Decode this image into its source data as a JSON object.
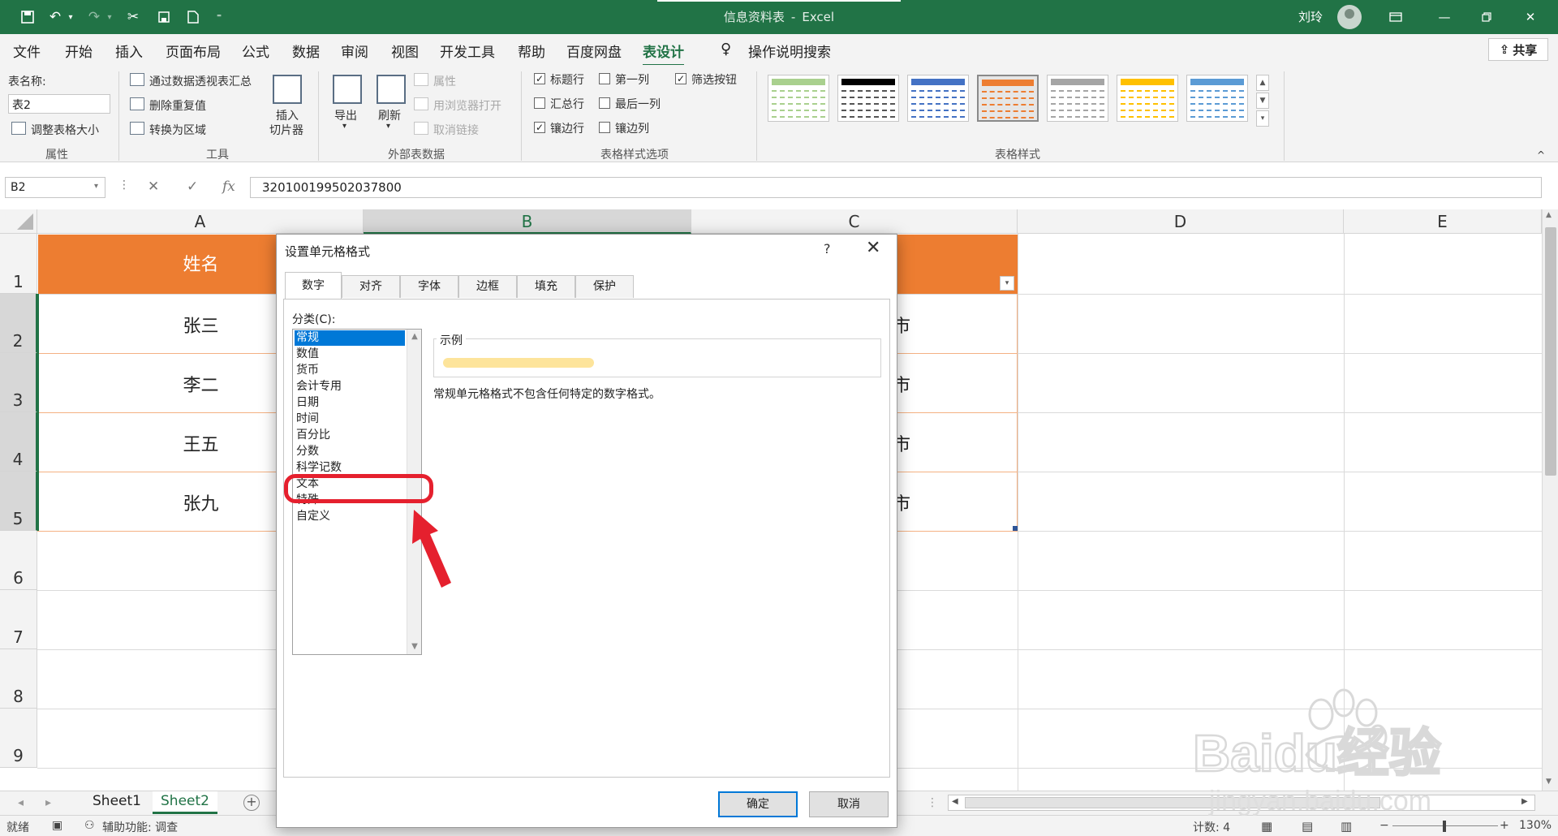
{
  "titlebar": {
    "doc_title": "信息资料表",
    "separator": "-",
    "app_name": "Excel",
    "user": "刘玲"
  },
  "menu": {
    "tabs": [
      "文件",
      "开始",
      "插入",
      "页面布局",
      "公式",
      "数据",
      "审阅",
      "视图",
      "开发工具",
      "帮助",
      "百度网盘",
      "表设计",
      "操作说明搜索"
    ],
    "active": "表设计",
    "share": "共享"
  },
  "ribbon": {
    "properties": {
      "table_name_label": "表名称:",
      "table_name_value": "表2",
      "resize": "调整表格大小",
      "group": "属性"
    },
    "tools": {
      "pivot": "通过数据透视表汇总",
      "remove_dup": "删除重复值",
      "convert": "转换为区域",
      "slicer_line1": "插入",
      "slicer_line2": "切片器",
      "group": "工具"
    },
    "external": {
      "export": "导出",
      "refresh": "刷新",
      "properties": "属性",
      "open_browser": "用浏览器打开",
      "unlink": "取消链接",
      "group": "外部表数据"
    },
    "style_options": {
      "header_row": "标题行",
      "total_row": "汇总行",
      "banded_rows": "镶边行",
      "first_col": "第一列",
      "last_col": "最后一列",
      "banded_cols": "镶边列",
      "filter_btn": "筛选按钮",
      "group": "表格样式选项",
      "checked": {
        "header_row": true,
        "total_row": false,
        "banded_rows": true,
        "first_col": false,
        "last_col": false,
        "banded_cols": false,
        "filter_btn": true
      }
    },
    "table_styles": {
      "group": "表格样式",
      "swatches": [
        "#a9d08e",
        "#000000",
        "#4472c4",
        "#ed7d31",
        "#a5a5a5",
        "#ffc000",
        "#5b9bd5"
      ],
      "selected_index": 3
    }
  },
  "formula_bar": {
    "name_box": "B2",
    "cancel": "✕",
    "enter": "✓",
    "fx": "fx",
    "value": "320100199502037800"
  },
  "grid": {
    "columns": [
      "A",
      "B",
      "C",
      "D",
      "E"
    ],
    "rows": [
      "1",
      "2",
      "3",
      "4",
      "5",
      "6",
      "7",
      "8",
      "9"
    ],
    "header_a": "姓名",
    "names": [
      "张三",
      "李二",
      "王五",
      "张九"
    ],
    "col_c_fragments": [
      "市",
      "市",
      "市",
      "市"
    ],
    "colors": {
      "header": "#ed7d31",
      "accent": "#217346"
    }
  },
  "sheets": {
    "tabs": [
      "Sheet1",
      "Sheet2"
    ],
    "active": "Sheet2",
    "add": "+"
  },
  "statusbar": {
    "ready": "就绪",
    "accessibility": "辅助功能: 调查",
    "count": "计数: 4",
    "zoom": "130%",
    "zoom_minus": "−",
    "zoom_plus": "+"
  },
  "dialog": {
    "title": "设置单元格格式",
    "help": "?",
    "close": "✕",
    "tabs": [
      "数字",
      "对齐",
      "字体",
      "边框",
      "填充",
      "保护"
    ],
    "active_tab": "数字",
    "category_label": "分类(C):",
    "categories": [
      "常规",
      "数值",
      "货币",
      "会计专用",
      "日期",
      "时间",
      "百分比",
      "分数",
      "科学记数",
      "文本",
      "特殊",
      "自定义"
    ],
    "selected_category": "常规",
    "sample_label": "示例",
    "description": "常规单元格格式不包含任何特定的数字格式。",
    "ok": "确定",
    "cancel": "取消"
  },
  "watermark": {
    "brand": "Baidu经验",
    "url": "jingyan.baidu.com"
  }
}
